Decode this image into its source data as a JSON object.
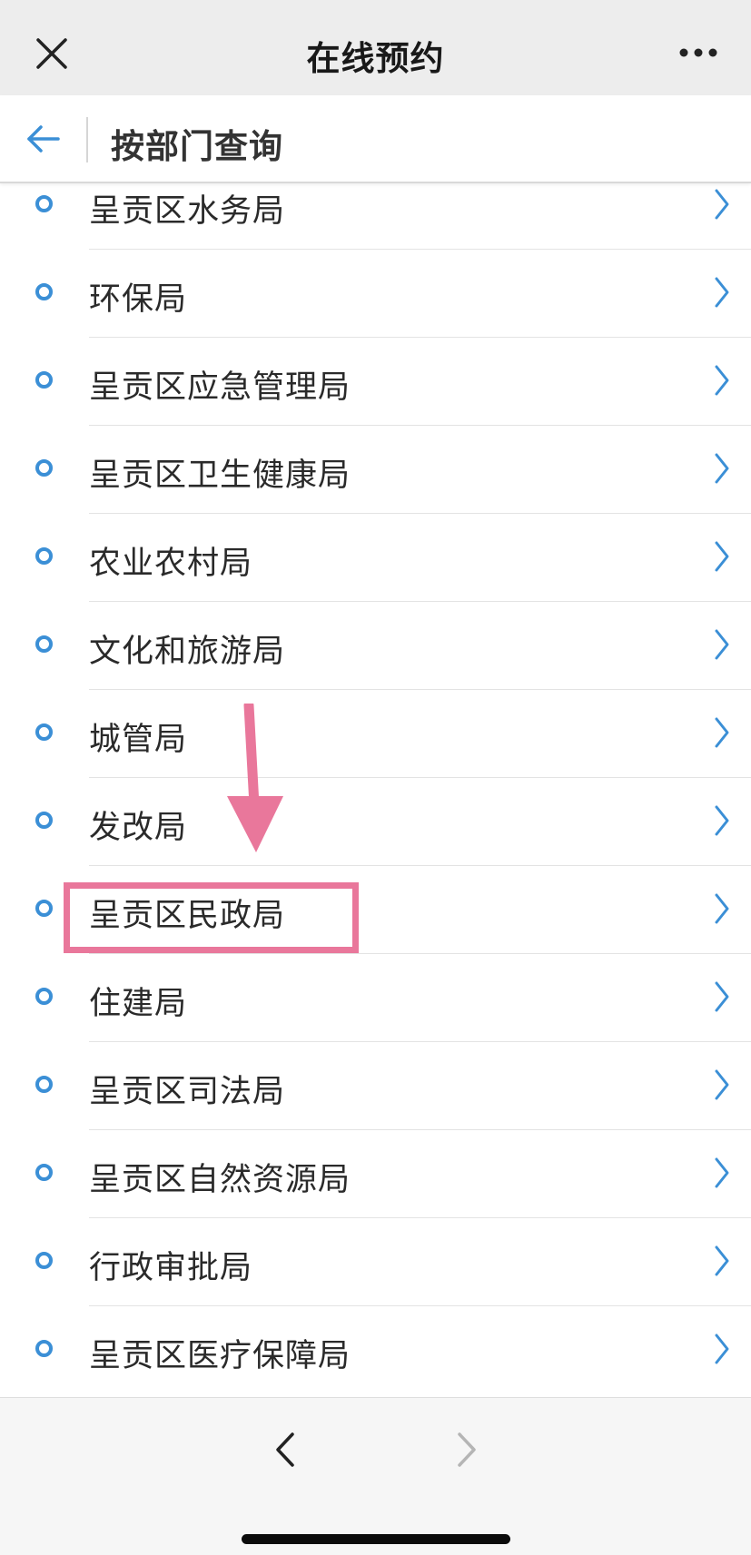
{
  "app_bar": {
    "title": "在线预约",
    "close_icon": "close-icon",
    "more_icon": "more-icon"
  },
  "sub_header": {
    "title": "按部门查询",
    "back_icon": "back-arrow-icon"
  },
  "departments": [
    {
      "label": "呈贡区水务局"
    },
    {
      "label": "环保局"
    },
    {
      "label": "呈贡区应急管理局"
    },
    {
      "label": "呈贡区卫生健康局"
    },
    {
      "label": "农业农村局"
    },
    {
      "label": "文化和旅游局"
    },
    {
      "label": "城管局"
    },
    {
      "label": "发改局"
    },
    {
      "label": "呈贡区民政局"
    },
    {
      "label": "住建局"
    },
    {
      "label": "呈贡区司法局"
    },
    {
      "label": "呈贡区自然资源局"
    },
    {
      "label": "行政审批局"
    },
    {
      "label": "呈贡区医疗保障局"
    }
  ],
  "highlighted_item": "呈贡区民政局",
  "colors": {
    "accent": "#3b8fd6",
    "annotation": "#e9779b",
    "app_bar_bg": "#ededed",
    "bottom_bar_bg": "#f6f6f6"
  },
  "bottom_bar": {
    "back_icon": "chevron-left-icon",
    "forward_icon": "chevron-right-icon",
    "forward_enabled": false
  }
}
